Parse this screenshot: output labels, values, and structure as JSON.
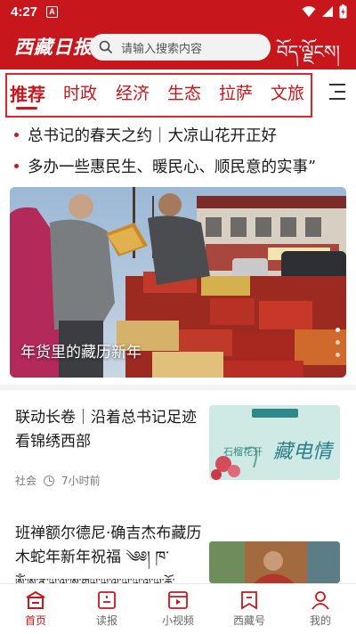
{
  "status_bar": {
    "time": "4:27",
    "notification_glyph": "A"
  },
  "header": {
    "logo": "西藏日报",
    "search_placeholder": "请输入搜索内容",
    "tibetan_logo": "བོད་ལྗོངས།"
  },
  "tabs": [
    {
      "label": "推荐",
      "active": true
    },
    {
      "label": "时政"
    },
    {
      "label": "经济"
    },
    {
      "label": "生态"
    },
    {
      "label": "拉萨"
    },
    {
      "label": "文旅"
    }
  ],
  "headlines": [
    "总书记的春天之约｜大凉山花开正好",
    "多办一些惠民生、暖民心、顺民意的实事”"
  ],
  "hero": {
    "caption": "年货里的藏历新年",
    "slide_count": 3,
    "active_slide": 1
  },
  "articles": [
    {
      "title": "联动长卷｜沿着总书记足迹 看锦绣西部",
      "category": "社会",
      "time": "7小时前",
      "thumb_text": "藏电情",
      "thumb_subtext": "石榴花开"
    },
    {
      "title": "班禅额尔德尼·确吉杰布藏历木蛇年新年祝福 ༄༅། ཁ་",
      "title_line3": "ༀ་ཨ་ན་ཡ་ལ་ཨ་གཡ་ཡ་ལ་ཡ་ཡཱ་ལ་ཡ་ཆོ་"
    }
  ],
  "bottom_nav": [
    {
      "label": "首页",
      "icon": "home-icon",
      "active": true
    },
    {
      "label": "读报",
      "icon": "newspaper-icon"
    },
    {
      "label": "小视频",
      "icon": "video-icon"
    },
    {
      "label": "西藏号",
      "icon": "bookmark-icon"
    },
    {
      "label": "我的",
      "icon": "profile-icon"
    }
  ],
  "colors": {
    "brand_red": "#c8161d",
    "highlight_box": "#e0242a"
  }
}
